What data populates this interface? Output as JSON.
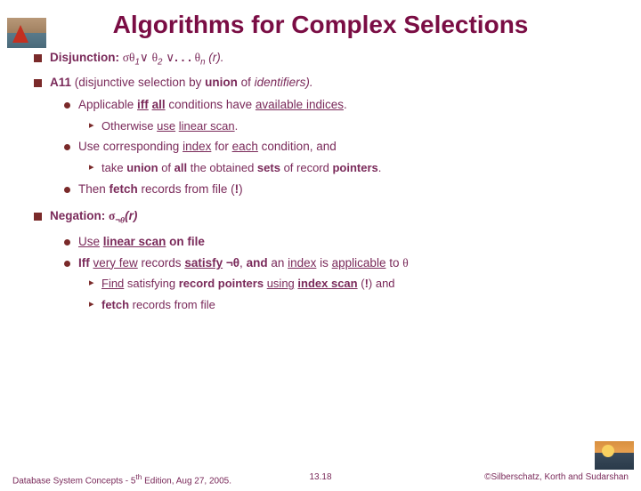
{
  "title": "Algorithms for Complex Selections",
  "item1": {
    "label": "Disjunction",
    "expr_parts": {
      "sigma": "σ",
      "t1": "θ",
      "s1": "1",
      "or1": "∨",
      "t2": "θ",
      "s2": "2",
      "or2": "∨",
      "dots": ". . .",
      "tn": "θ",
      "sn": "n",
      "tail": " (r)."
    }
  },
  "item2": {
    "label": "A11 (disjunctive selection by union of identifiers).",
    "sub1": "Applicable iff all  conditions have available indices.",
    "sub1a": "Otherwise use linear scan.",
    "sub2": "Use corresponding index for each condition, and",
    "sub2a": "take union of all the obtained sets of record pointers.",
    "sub3_pre": "Then fetch records from file (",
    "sub3_bang": "!",
    "sub3_post": ")"
  },
  "item3": {
    "label": "Negation",
    "expr_parts": {
      "sigma": "σ",
      "not": "¬",
      "theta": "θ",
      "tail": "(r)"
    },
    "sub1": "Use linear scan on file",
    "sub2_pre": "Iff very few records satisfy ",
    "sub2_nt": "¬θ",
    "sub2_mid": ", and an index is applicable to ",
    "sub2_theta": "θ",
    "sub2a_pre": "Find satisfying record pointers using index scan (",
    "sub2a_bang": "!",
    "sub2a_post": ") and",
    "sub2b": "fetch records from file"
  },
  "footer": {
    "left": "Database System Concepts - 5th Edition, Aug 27,  2005.",
    "center": "13.18",
    "right": "©Silberschatz, Korth and Sudarshan"
  }
}
